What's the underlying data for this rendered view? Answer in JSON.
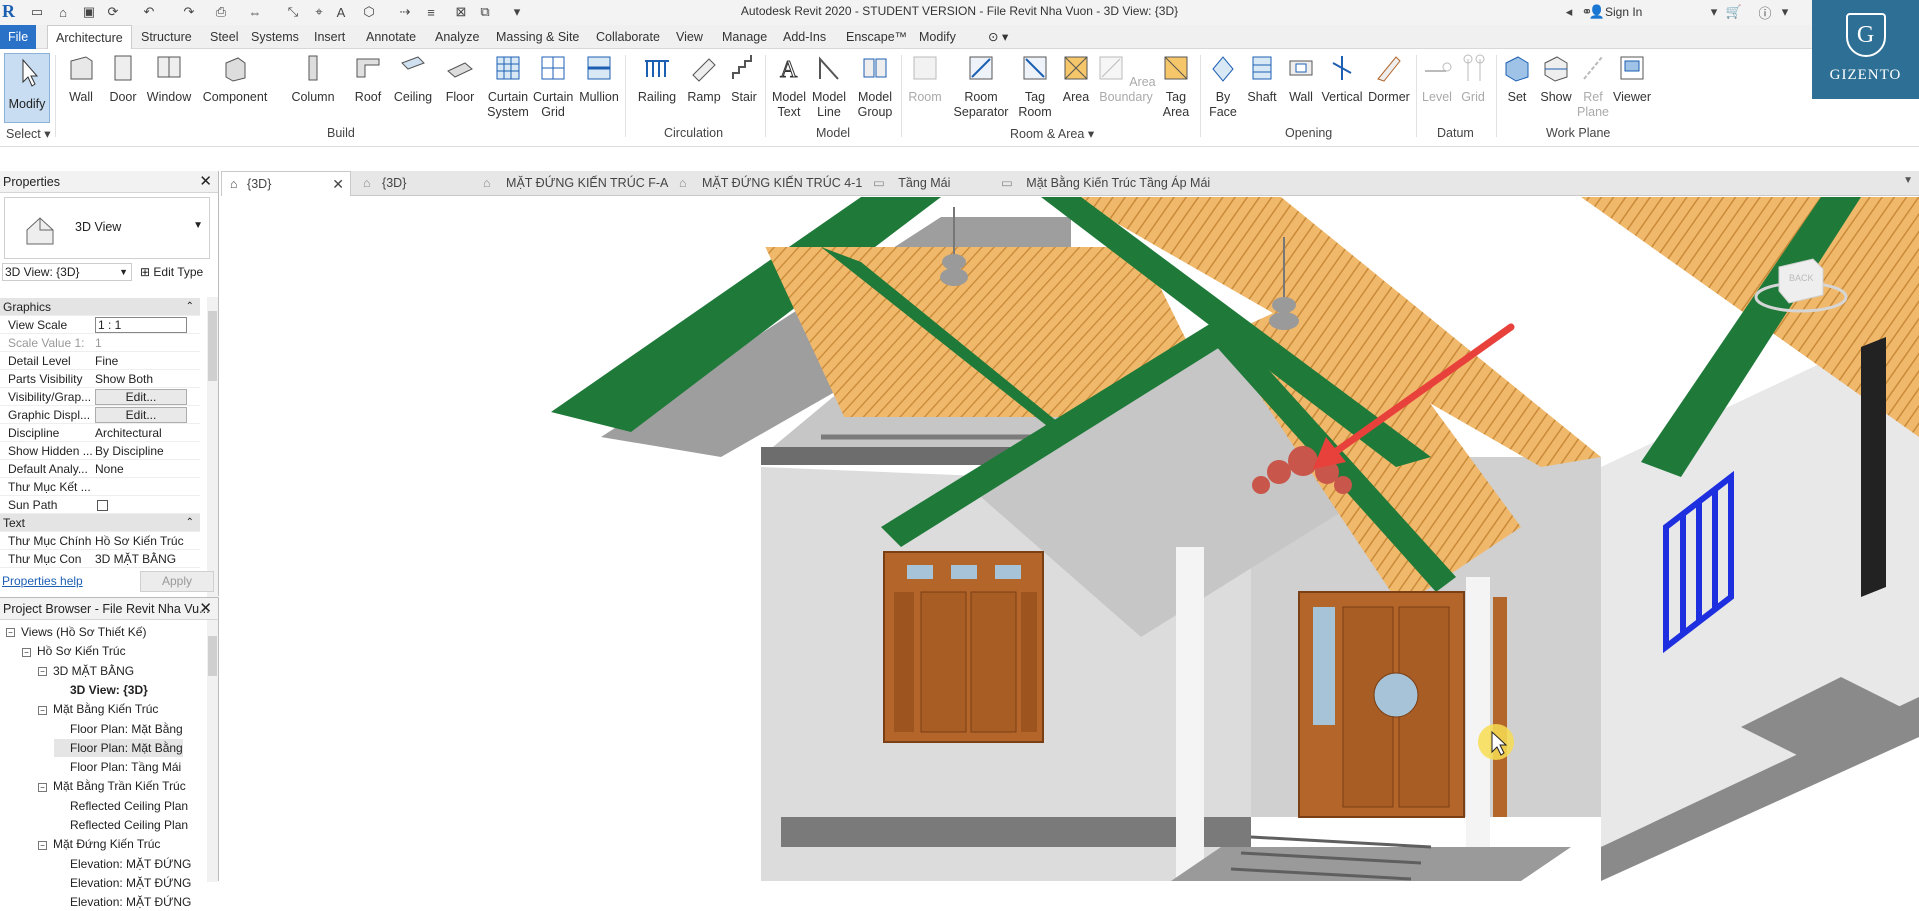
{
  "titlebar": {
    "title": "Autodesk Revit 2020 - STUDENT VERSION - File Revit Nha Vuon - 3D View: {3D}",
    "sign_in": "Sign In"
  },
  "menu": {
    "tabs": [
      "File",
      "Architecture",
      "Structure",
      "Steel",
      "Systems",
      "Insert",
      "Annotate",
      "Analyze",
      "Massing & Site",
      "Collaborate",
      "View",
      "Manage",
      "Add-Ins",
      "Enscape™",
      "Modify"
    ]
  },
  "ribbon": {
    "select": {
      "modify": "Modify",
      "select_label": "Select ▾"
    },
    "build": {
      "label": "Build",
      "tools": [
        "Wall",
        "Door",
        "Window",
        "Component",
        "Column",
        "Roof",
        "Ceiling",
        "Floor",
        "Curtain System",
        "Curtain Grid",
        "Mullion"
      ]
    },
    "circulation": {
      "label": "Circulation",
      "tools": [
        "Railing",
        "Ramp",
        "Stair"
      ]
    },
    "model": {
      "label": "Model",
      "tools": [
        "Model Text",
        "Model Line",
        "Model Group"
      ]
    },
    "room_area": {
      "label": "Room & Area ▾",
      "tools": [
        "Room",
        "Room Separator",
        "Tag Room",
        "Area",
        "Area Boundary",
        "Tag Area"
      ]
    },
    "opening": {
      "label": "Opening",
      "tools": [
        "By Face",
        "Shaft",
        "Wall",
        "Vertical",
        "Dormer"
      ]
    },
    "datum": {
      "label": "Datum",
      "tools": [
        "Level",
        "Grid"
      ]
    },
    "work_plane": {
      "label": "Work Plane",
      "tools": [
        "Set",
        "Show",
        "Ref Plane",
        "Viewer"
      ]
    }
  },
  "brand": {
    "letter": "G",
    "name": "GIZENTO"
  },
  "view_tabs": [
    "{3D}",
    "{3D}",
    "MẶT ĐỨNG KIẾN TRÚC F-A",
    "MẶT ĐỨNG KIẾN TRÚC 4-1",
    "Tầng Mái",
    "Mặt Bằng Kiến Trúc Tầng Áp Mái"
  ],
  "properties": {
    "title": "Properties",
    "type_name": "3D View",
    "selector": "3D View: {3D}",
    "edit_type": "Edit Type",
    "rows": [
      {
        "k": "Graphics",
        "v": "",
        "group": true
      },
      {
        "k": "View Scale",
        "v": "1 : 1"
      },
      {
        "k": "Scale Value   1:",
        "v": "1"
      },
      {
        "k": "Detail Level",
        "v": "Fine"
      },
      {
        "k": "Parts Visibility",
        "v": "Show Both"
      },
      {
        "k": "Visibility/Grap...",
        "v": "Edit...",
        "button": true
      },
      {
        "k": "Graphic Displ...",
        "v": "Edit...",
        "button": true
      },
      {
        "k": "Discipline",
        "v": "Architectural"
      },
      {
        "k": "Show Hidden ...",
        "v": "By Discipline"
      },
      {
        "k": "Default Analy...",
        "v": "None"
      },
      {
        "k": "Thư Mục Kết ...",
        "v": ""
      },
      {
        "k": "Sun Path",
        "v": ""
      },
      {
        "k": "Text",
        "v": "",
        "group": true
      },
      {
        "k": "Thư Mục Chính",
        "v": "Hồ Sơ Kiến Trúc"
      },
      {
        "k": "Thư Mục Con",
        "v": "3D MẶT BẰNG"
      }
    ],
    "help": "Properties help",
    "apply": "Apply"
  },
  "browser": {
    "title": "Project Browser - File Revit Nha Vu...",
    "items": [
      {
        "label": "Views (Hồ Sơ Thiết Kế)",
        "level": 0,
        "toggle": "−"
      },
      {
        "label": "Hồ Sơ Kiến Trúc",
        "level": 1,
        "toggle": "−"
      },
      {
        "label": "3D MẶT BẰNG",
        "level": 2,
        "toggle": "−"
      },
      {
        "label": "3D View: {3D}",
        "level": 3,
        "toggle": ""
      },
      {
        "label": "Mặt Bằng Kiến Trúc",
        "level": 2,
        "toggle": "−"
      },
      {
        "label": "Floor Plan: Mặt Bằng",
        "level": 3,
        "toggle": ""
      },
      {
        "label": "Floor Plan: Mặt Bằng",
        "level": 3,
        "toggle": ""
      },
      {
        "label": "Floor Plan: Tầng Mái",
        "level": 3,
        "toggle": ""
      },
      {
        "label": "Mặt Bằng Trần Kiến Trúc",
        "level": 2,
        "toggle": "−"
      },
      {
        "label": "Reflected Ceiling Plan",
        "level": 3,
        "toggle": ""
      },
      {
        "label": "Reflected Ceiling Plan",
        "level": 3,
        "toggle": ""
      },
      {
        "label": "Mặt Đứng Kiến Trúc",
        "level": 2,
        "toggle": "−"
      },
      {
        "label": "Elevation: MẶT ĐỨNG",
        "level": 3,
        "toggle": ""
      },
      {
        "label": "Elevation: MẶT ĐỨNG",
        "level": 3,
        "toggle": ""
      },
      {
        "label": "Elevation: MẶT ĐỨNG",
        "level": 3,
        "toggle": ""
      }
    ]
  },
  "viewcube": {
    "face": "BACK"
  },
  "colors": {
    "accent": "#2a71c8",
    "roof_trim": "#1f7a3a",
    "tile": "#f0b86a",
    "door": "#b4652a",
    "arrow": "#e8413c"
  }
}
